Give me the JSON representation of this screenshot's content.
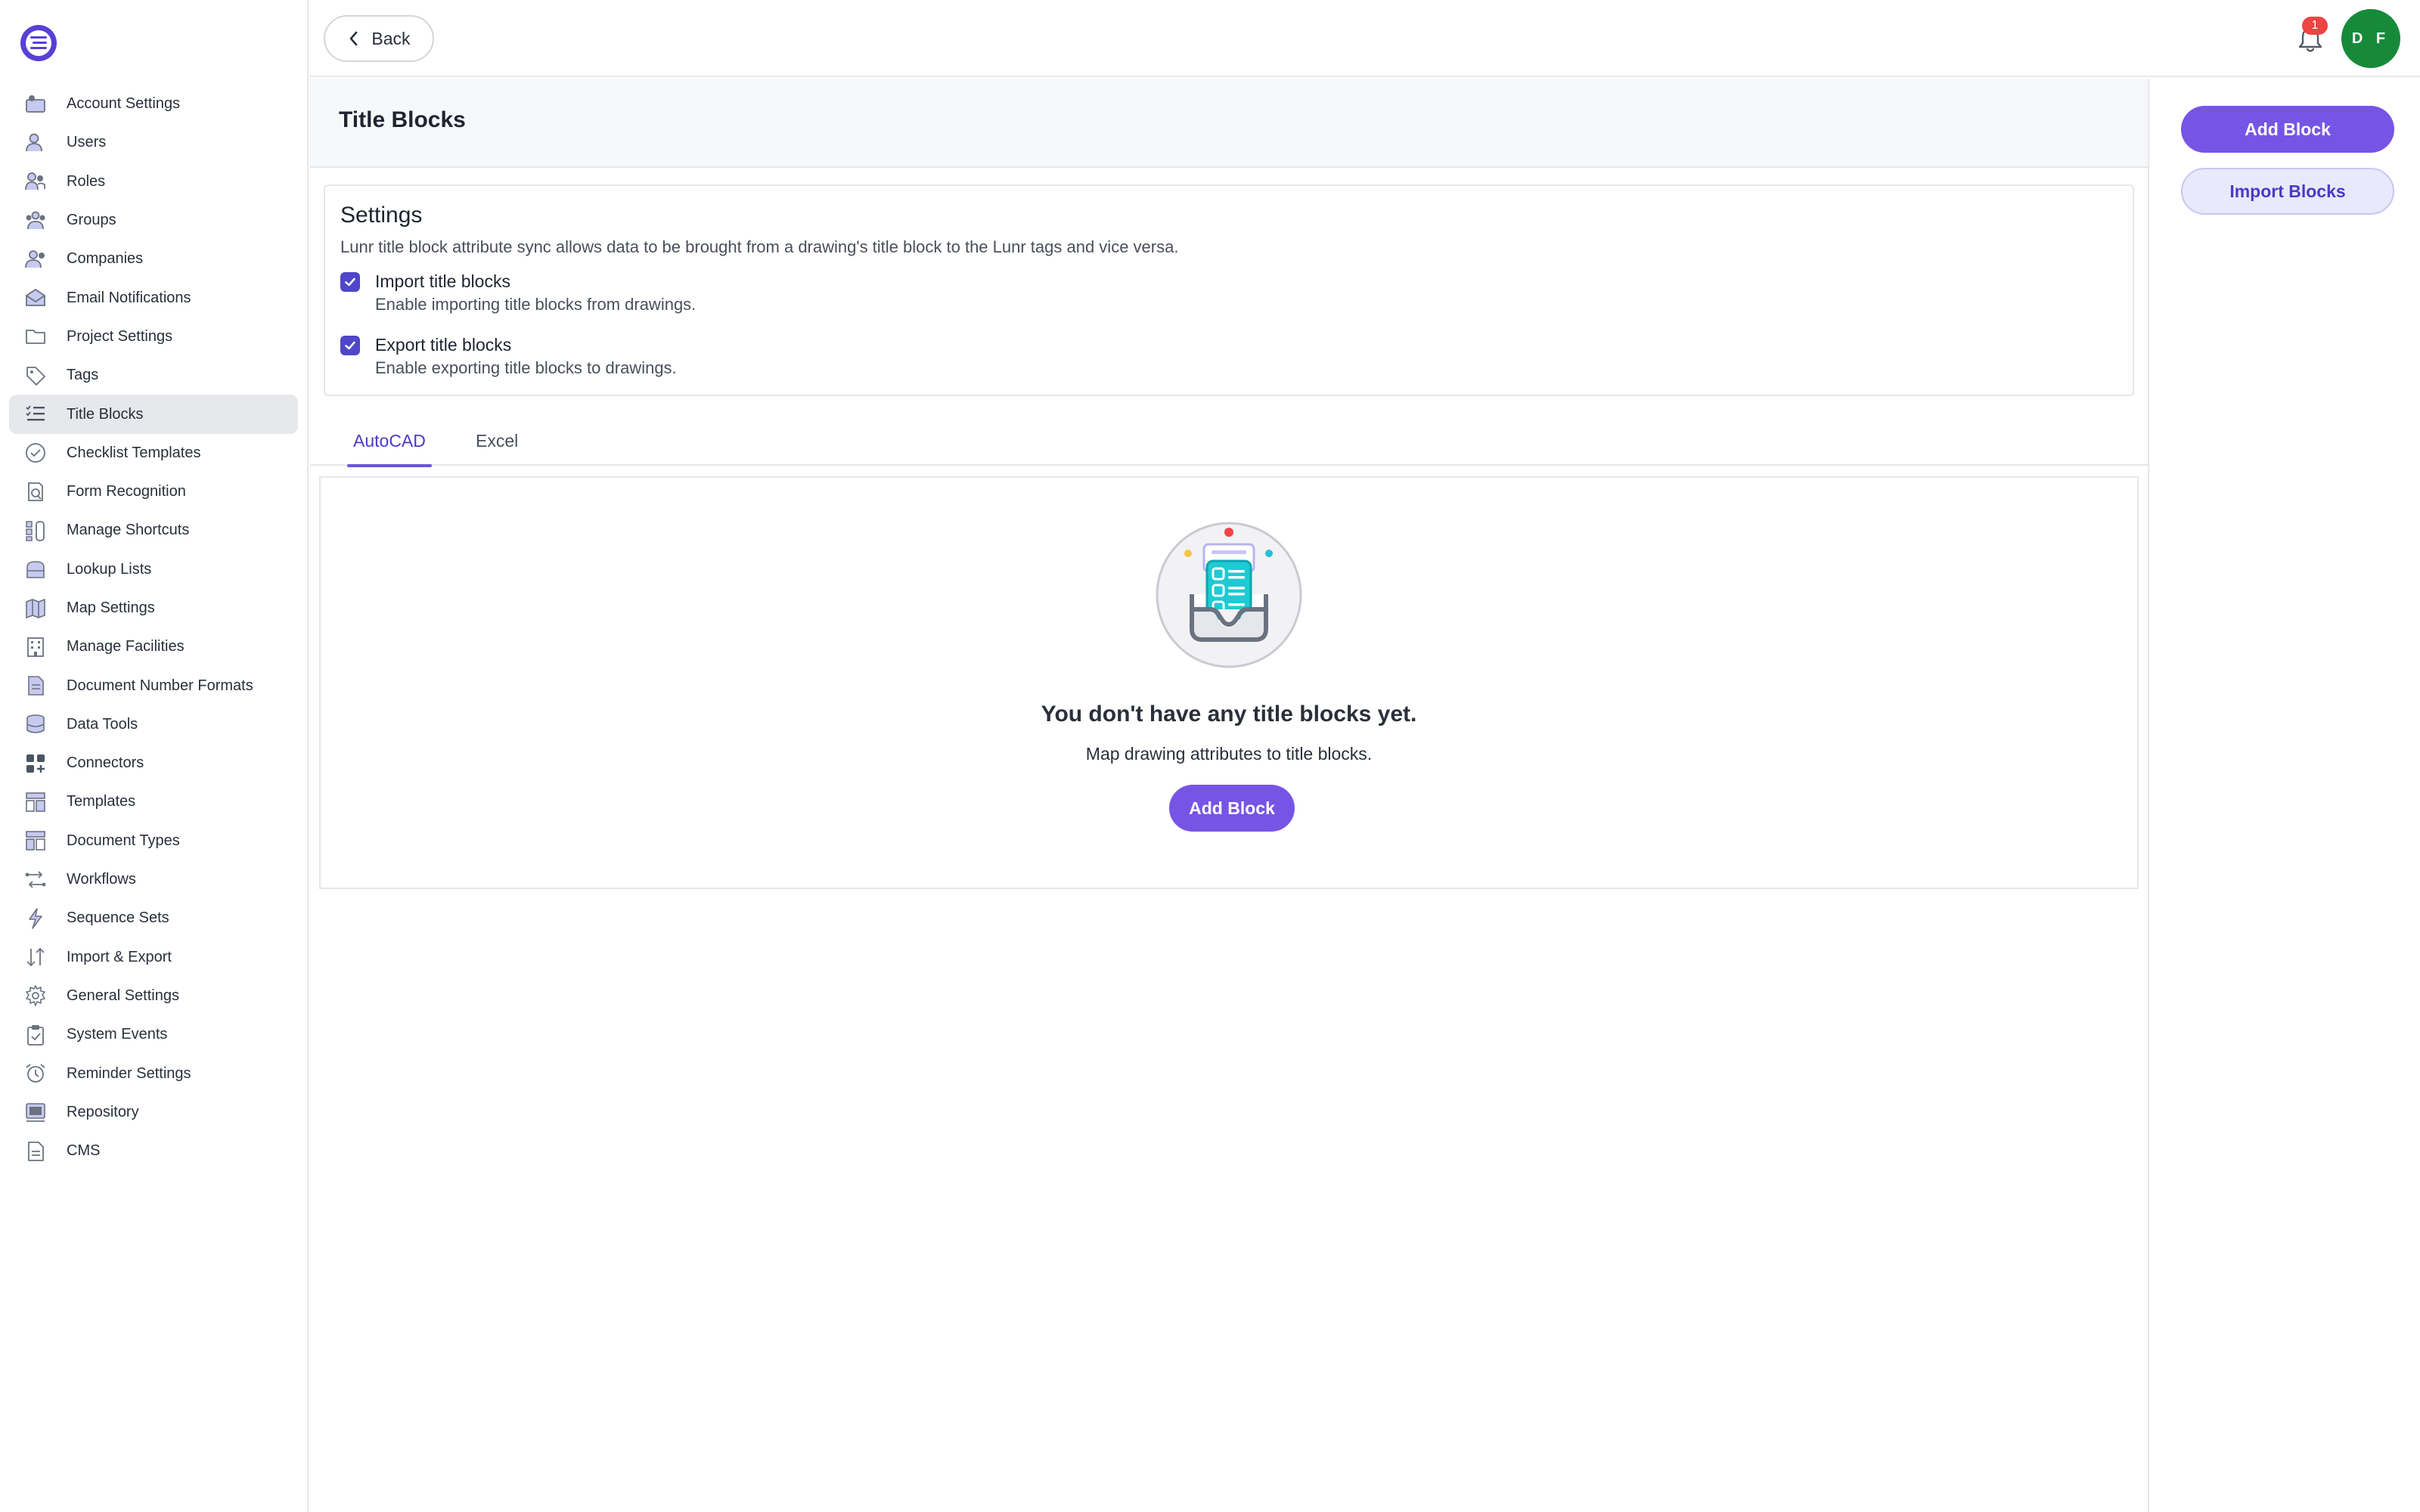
{
  "topbar": {
    "back_label": "Back",
    "notification_count": "1",
    "avatar_initials": "D F",
    "avatar_color": "#178a3a"
  },
  "sidebar": {
    "items": [
      {
        "label": "Account Settings",
        "icon": "account-settings-icon"
      },
      {
        "label": "Users",
        "icon": "user-icon"
      },
      {
        "label": "Roles",
        "icon": "roles-icon"
      },
      {
        "label": "Groups",
        "icon": "groups-icon"
      },
      {
        "label": "Companies",
        "icon": "companies-icon"
      },
      {
        "label": "Email Notifications",
        "icon": "email-icon"
      },
      {
        "label": "Project Settings",
        "icon": "folder-icon"
      },
      {
        "label": "Tags",
        "icon": "tag-icon"
      },
      {
        "label": "Title Blocks",
        "icon": "list-check-icon",
        "active": true
      },
      {
        "label": "Checklist Templates",
        "icon": "check-circle-icon"
      },
      {
        "label": "Form Recognition",
        "icon": "form-search-icon"
      },
      {
        "label": "Manage Shortcuts",
        "icon": "shortcuts-icon"
      },
      {
        "label": "Lookup Lists",
        "icon": "lookup-icon"
      },
      {
        "label": "Map Settings",
        "icon": "map-icon"
      },
      {
        "label": "Manage Facilities",
        "icon": "building-icon"
      },
      {
        "label": "Document Number Formats",
        "icon": "document-number-icon"
      },
      {
        "label": "Data Tools",
        "icon": "database-icon"
      },
      {
        "label": "Connectors",
        "icon": "connectors-icon"
      },
      {
        "label": "Templates",
        "icon": "templates-icon"
      },
      {
        "label": "Document Types",
        "icon": "document-types-icon"
      },
      {
        "label": "Workflows",
        "icon": "workflow-icon"
      },
      {
        "label": "Sequence Sets",
        "icon": "sequence-icon"
      },
      {
        "label": "Import & Export",
        "icon": "import-export-icon"
      },
      {
        "label": "General Settings",
        "icon": "gear-icon"
      },
      {
        "label": "System Events",
        "icon": "clipboard-check-icon"
      },
      {
        "label": "Reminder Settings",
        "icon": "alarm-icon"
      },
      {
        "label": "Repository",
        "icon": "repository-icon"
      },
      {
        "label": "CMS",
        "icon": "file-icon"
      }
    ]
  },
  "page": {
    "title": "Title Blocks"
  },
  "actions": {
    "add_block": "Add Block",
    "import_blocks": "Import Blocks"
  },
  "settings": {
    "title": "Settings",
    "description": "Lunr title block attribute sync allows data to be brought from a drawing's title block to the Lunr tags and vice versa.",
    "options": [
      {
        "label": "Import title blocks",
        "help": "Enable importing title blocks from drawings.",
        "checked": true
      },
      {
        "label": "Export title blocks",
        "help": "Enable exporting title blocks to drawings.",
        "checked": true
      }
    ]
  },
  "tabs": [
    {
      "label": "AutoCAD",
      "active": true
    },
    {
      "label": "Excel",
      "active": false
    }
  ],
  "empty_state": {
    "title": "You don't have any title blocks yet.",
    "subtitle": "Map drawing attributes to title blocks.",
    "button": "Add Block"
  },
  "colors": {
    "accent": "#7655e5",
    "accent_dark": "#4b3ac6",
    "badge": "#ef4444"
  }
}
